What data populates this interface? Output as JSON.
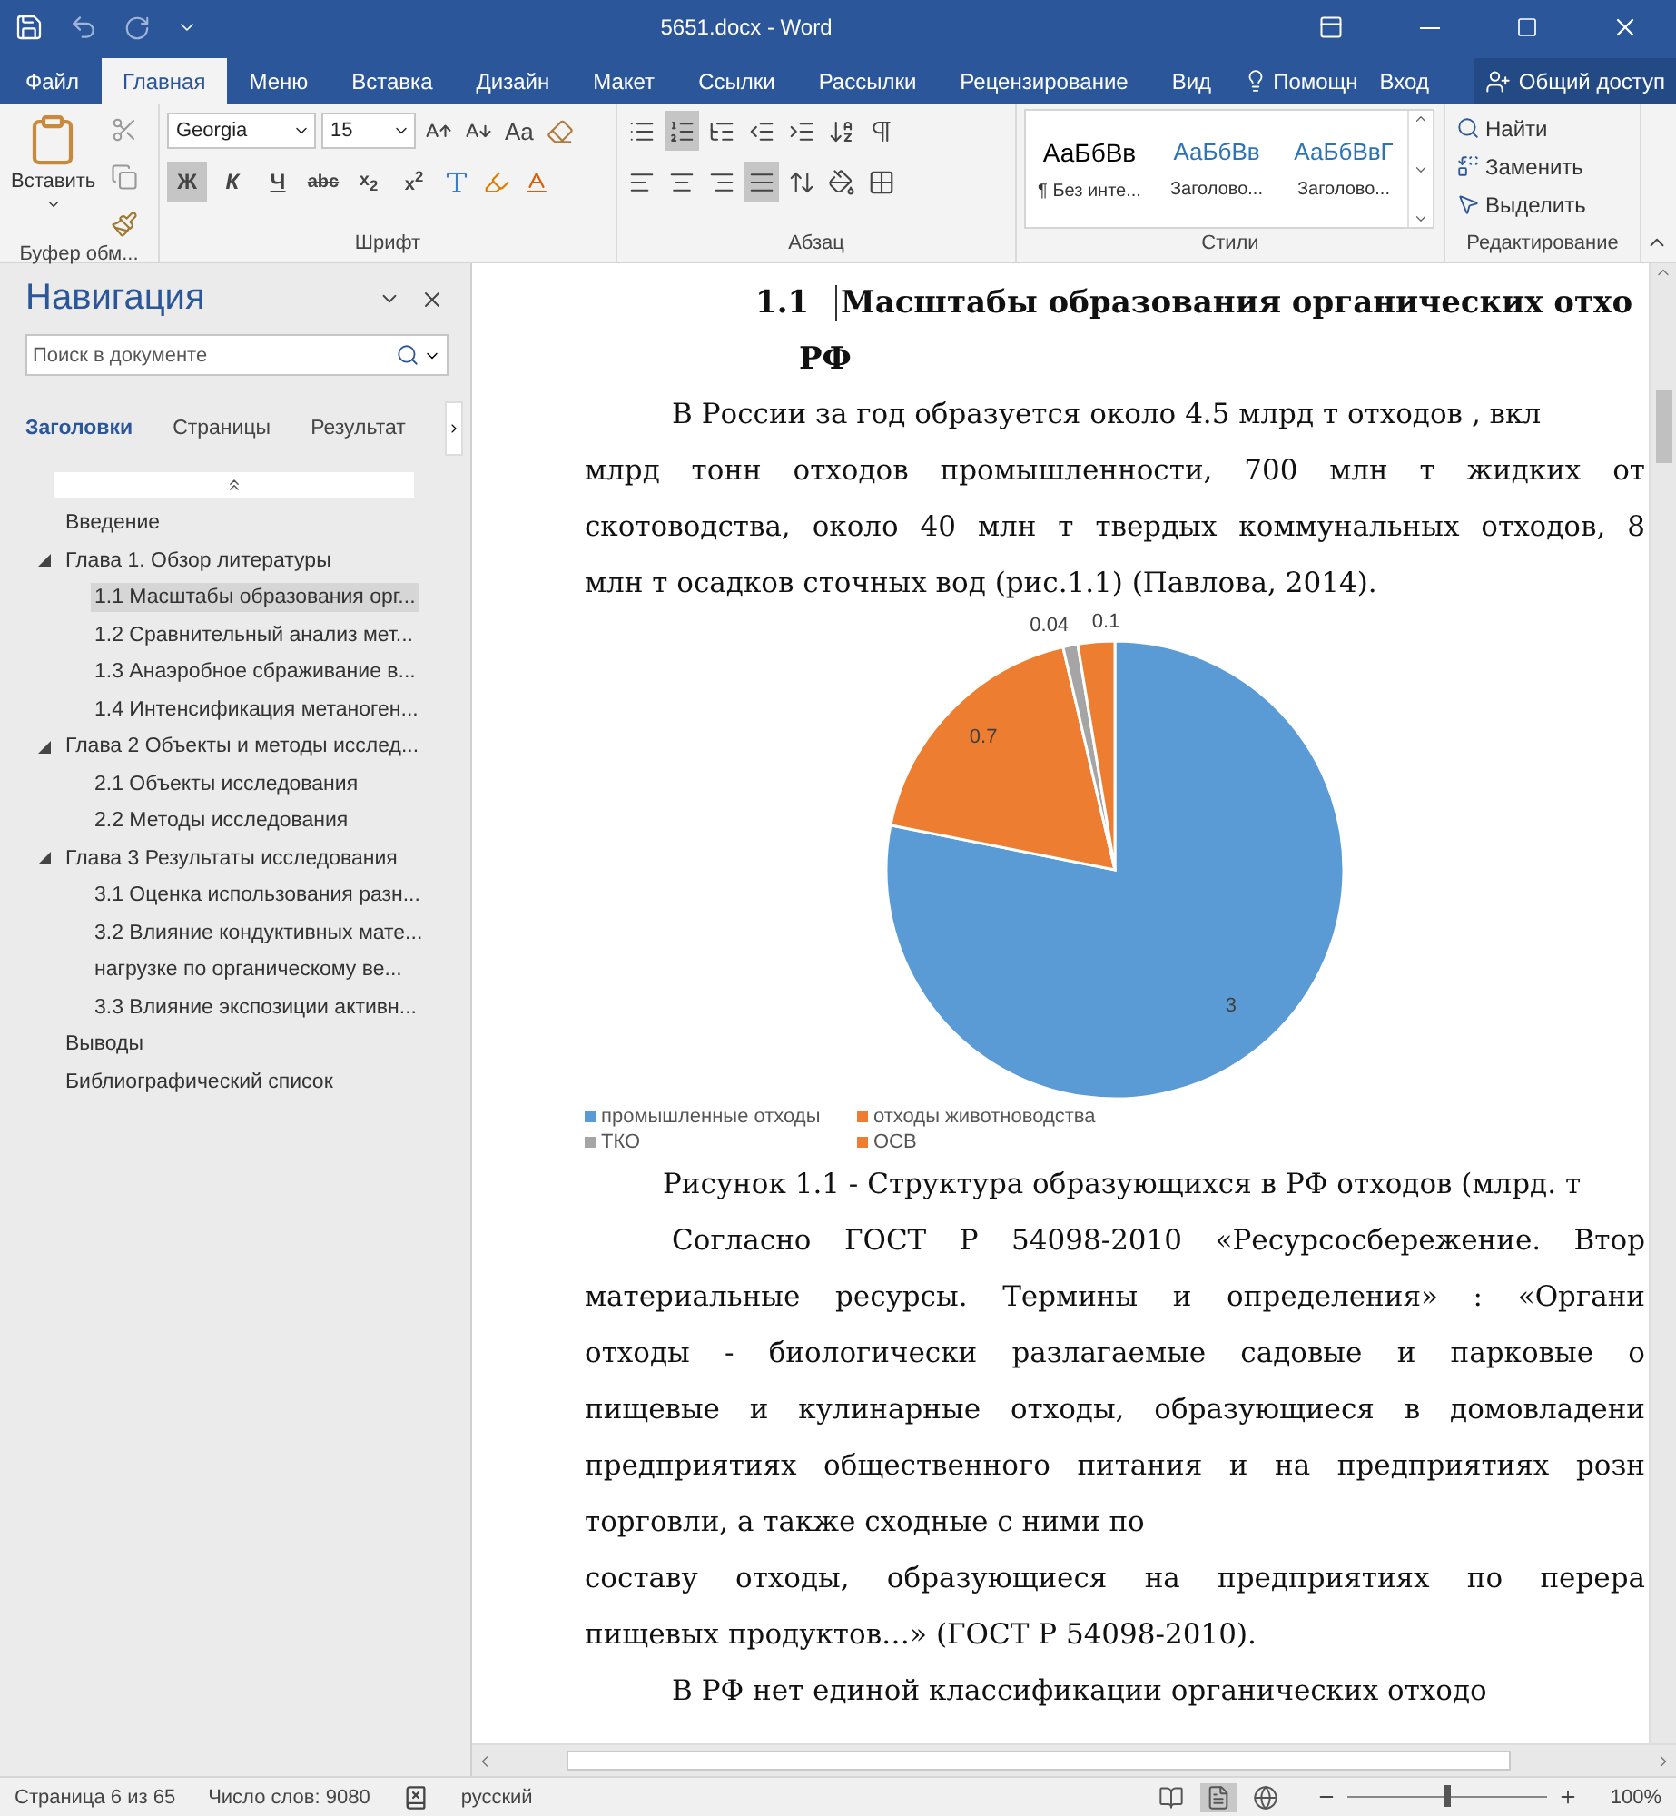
{
  "title_bar": {
    "title": "5651.docx - Word"
  },
  "menu_tabs": [
    {
      "label": "Файл",
      "selected": false
    },
    {
      "label": "Главная",
      "selected": true
    },
    {
      "label": "Меню",
      "selected": false
    },
    {
      "label": "Вставка",
      "selected": false
    },
    {
      "label": "Дизайн",
      "selected": false
    },
    {
      "label": "Макет",
      "selected": false
    },
    {
      "label": "Ссылки",
      "selected": false
    },
    {
      "label": "Рассылки",
      "selected": false
    },
    {
      "label": "Рецензирование",
      "selected": false
    },
    {
      "label": "Вид",
      "selected": false
    }
  ],
  "tell_me": "Помощн",
  "sign_in": "Вход",
  "share": "Общий доступ",
  "ribbon": {
    "clipboard": {
      "label": "Буфер обм...",
      "paste": "Вставить"
    },
    "font": {
      "label": "Шрифт",
      "font_name": "Georgia",
      "font_size": "15",
      "case_button": "Aa",
      "format_buttons": [
        {
          "label": "Ж",
          "selected": true
        },
        {
          "label": "К",
          "selected": false
        },
        {
          "label": "Ч",
          "selected": false
        },
        {
          "label": "abc",
          "selected": false
        },
        {
          "label": "x$_{2}$",
          "selected": false
        },
        {
          "label": "x$^{2}$",
          "selected": false
        }
      ]
    },
    "paragraph": {
      "label": "Абзац",
      "alignments": [
        {
          "kind": "left",
          "selected": false
        },
        {
          "kind": "center",
          "selected": false
        },
        {
          "kind": "right",
          "selected": false
        },
        {
          "kind": "justify",
          "selected": true
        }
      ]
    },
    "styles": {
      "label": "Стили",
      "items": [
        {
          "preview": "АаБбВв",
          "name": "¶ Без инте...",
          "kind": "normal"
        },
        {
          "preview": "АаБбВв",
          "name": "Заголово...",
          "kind": "heading1"
        },
        {
          "preview": "АаБбВвГ",
          "name": "Заголово...",
          "kind": "heading2"
        }
      ]
    },
    "editing": {
      "label": "Редактирование",
      "items": [
        {
          "kind": "find",
          "label": "Найти"
        },
        {
          "kind": "replace",
          "label": "Заменить"
        },
        {
          "kind": "select",
          "label": "Выделить"
        }
      ]
    }
  },
  "navigation": {
    "title": "Навигация",
    "search": {
      "placeholder": "Поиск в документе"
    },
    "tabs": [
      {
        "label": "Заголовки",
        "selected": true
      },
      {
        "label": "Страницы",
        "selected": false
      },
      {
        "label": "Результат",
        "selected": false
      }
    ],
    "headings": [
      {
        "label": "Введение",
        "selected": false
      },
      {
        "label": "Глава 1. Обзор литературы",
        "selected": false,
        "expanded": true,
        "children": [
          {
            "label": "1.1 Масштабы образования орг...",
            "selected": true
          },
          {
            "label": "1.2 Сравнительный анализ мет...",
            "selected": false
          },
          {
            "label": "1.3 Анаэробное сбраживание в...",
            "selected": false
          },
          {
            "label": "1.4 Интенсификация метаноген...",
            "selected": false
          }
        ]
      },
      {
        "label": "Глава 2 Объекты и методы исслед...",
        "selected": false,
        "expanded": true,
        "children": [
          {
            "label": "2.1 Объекты исследования",
            "selected": false
          },
          {
            "label": "2.2 Методы исследования",
            "selected": false
          }
        ]
      },
      {
        "label": "Глава 3 Результаты исследования",
        "selected": false,
        "expanded": true,
        "children": [
          {
            "label": "3.1 Оценка использования разн...",
            "selected": false
          },
          {
            "label": "3.2 Влияние кондуктивных мате...",
            "selected": false
          },
          {
            "label": "нагрузке по органическому ве...",
            "selected": false
          },
          {
            "label": "3.3 Влияние экспозиции активн...",
            "selected": false
          }
        ]
      },
      {
        "label": "Выводы",
        "selected": false
      },
      {
        "label": "Библиографический список",
        "selected": false
      }
    ]
  },
  "document": {
    "heading": {
      "number": "1.1",
      "text": "Масштабы образования органических отхо",
      "continuation": "РФ"
    },
    "paragraph_1": [
      {
        "text": "В России за год образуется около 4.5 млрд т отходов , вкл",
        "kind": "first"
      },
      {
        "text": "млрд тонн отходов промышленности, 700 млн т жидких от",
        "kind": "full"
      },
      {
        "text": "скотоводства, около 40 млн т твердых коммунальных отходов, 8",
        "kind": "full"
      },
      {
        "text": "млн т осадков сточных вод (рис.1.1) (Павлова, 2014).",
        "kind": "last"
      }
    ],
    "chart_data": {
      "type": "pie",
      "categories": [
        "промышленные отходы",
        "отходы животноводства",
        "ТКО",
        "ОСВ"
      ],
      "values": [
        3,
        0.7,
        0.04,
        0.1
      ],
      "colors": [
        "#5b9bd5",
        "#ed7d31",
        "#a5a5a5",
        "#ed7d31"
      ],
      "data_labels": true,
      "legend": "bottom"
    },
    "caption": "Рисунок 1.1 - Структура образующихся в РФ отходов (млрд. т",
    "paragraph_2": [
      {
        "text": "Согласно ГОСТ Р 54098-2010 «Ресурсосбережение. Втор",
        "kind": "first-full"
      },
      {
        "text": "материальные ресурсы. Термины и определения» : «Органи",
        "kind": "full"
      },
      {
        "text": "отходы - биологически разлагаемые садовые и парковые о",
        "kind": "full"
      },
      {
        "text": "пищевые и кулинарные отходы, образующиеся в домовладени",
        "kind": "full"
      },
      {
        "text": "предприятиях общественного питания и на предприятиях розн",
        "kind": "full"
      },
      {
        "text": "торговли, а также сходные с ними по",
        "kind": "last"
      },
      {
        "text": "составу отходы, образующиеся на предприятиях по перера",
        "kind": "full"
      },
      {
        "text": "пищевых продуктов…» (ГОСТ Р 54098-2010).",
        "kind": "last"
      }
    ],
    "paragraph_3": [
      {
        "text": "В РФ нет единой классификации органических отходо",
        "kind": "first"
      }
    ]
  },
  "status_bar": {
    "page": "Страница 6 из 65",
    "words": "Число слов: 9080",
    "language": "русский",
    "views": [
      {
        "kind": "read",
        "selected": false
      },
      {
        "kind": "print",
        "selected": true
      },
      {
        "kind": "web",
        "selected": false
      }
    ],
    "zoom": {
      "level": 0.5,
      "reading": "100%"
    }
  }
}
